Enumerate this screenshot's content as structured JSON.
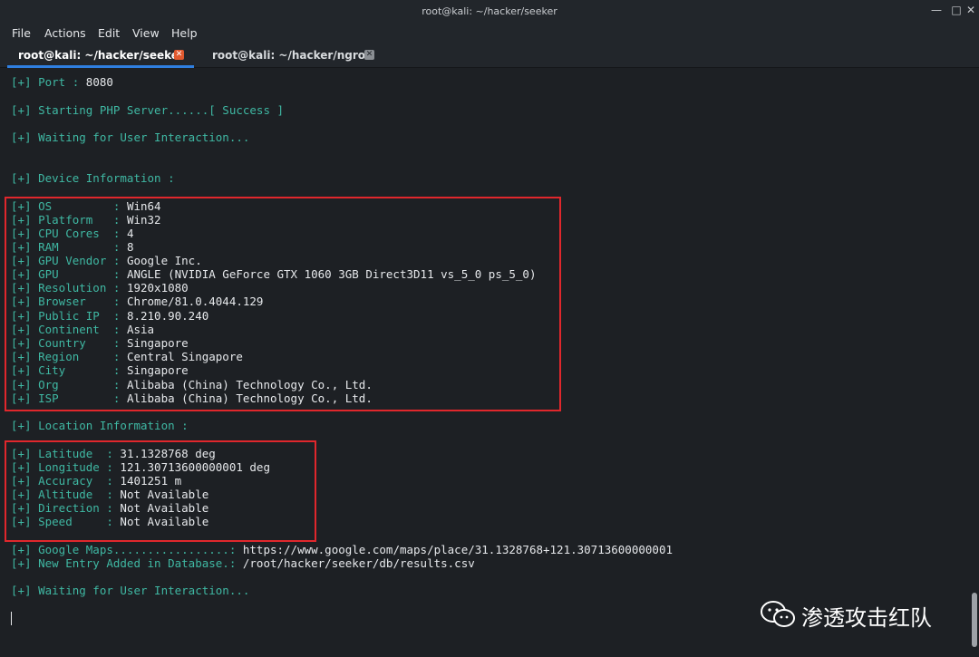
{
  "window": {
    "title": "root@kali: ~/hacker/seeker"
  },
  "menu": {
    "file": "File",
    "actions": "Actions",
    "edit": "Edit",
    "view": "View",
    "help": "Help"
  },
  "tabs": [
    {
      "label": "root@kali: ~/hacker/seeker"
    },
    {
      "label": "root@kali: ~/hacker/ngrok"
    }
  ],
  "terminal": {
    "prefix": "[+]",
    "lines": {
      "port": {
        "label": " Port : ",
        "value": "8080"
      },
      "php": {
        "label": " Starting PHP Server......[ Success ]"
      },
      "wait1": {
        "label": " Waiting for User Interaction..."
      },
      "devhdr": {
        "label": " Device Information :"
      },
      "os": {
        "label": " OS         : ",
        "value": "Win64"
      },
      "platform": {
        "label": " Platform   : ",
        "value": "Win32"
      },
      "cpu": {
        "label": " CPU Cores  : ",
        "value": "4"
      },
      "ram": {
        "label": " RAM        : ",
        "value": "8"
      },
      "gpuvendor": {
        "label": " GPU Vendor : ",
        "value": "Google Inc."
      },
      "gpu": {
        "label": " GPU        : ",
        "value": "ANGLE (NVIDIA GeForce GTX 1060 3GB Direct3D11 vs_5_0 ps_5_0)"
      },
      "resolution": {
        "label": " Resolution : ",
        "value": "1920x1080"
      },
      "browser": {
        "label": " Browser    : ",
        "value": "Chrome/81.0.4044.129"
      },
      "publicip": {
        "label": " Public IP  : ",
        "value": "8.210.90.240"
      },
      "continent": {
        "label": " Continent  : ",
        "value": "Asia"
      },
      "country": {
        "label": " Country    : ",
        "value": "Singapore"
      },
      "region": {
        "label": " Region     : ",
        "value": "Central Singapore"
      },
      "city": {
        "label": " City       : ",
        "value": "Singapore"
      },
      "org": {
        "label": " Org        : ",
        "value": "Alibaba (China) Technology Co., Ltd."
      },
      "isp": {
        "label": " ISP        : ",
        "value": "Alibaba (China) Technology Co., Ltd."
      },
      "lochdr": {
        "label": " Location Information :"
      },
      "latitude": {
        "label": " Latitude  : ",
        "value": "31.1328768 deg"
      },
      "longitude": {
        "label": " Longitude : ",
        "value": "121.30713600000001 deg"
      },
      "accuracy": {
        "label": " Accuracy  : ",
        "value": "1401251 m"
      },
      "altitude": {
        "label": " Altitude  : ",
        "value": "Not Available"
      },
      "direction": {
        "label": " Direction : ",
        "value": "Not Available"
      },
      "speed": {
        "label": " Speed     : ",
        "value": "Not Available"
      },
      "maps": {
        "label": " Google Maps.................: ",
        "value": "https://www.google.com/maps/place/31.1328768+121.30713600000001"
      },
      "db": {
        "label": " New Entry Added in Database.: ",
        "value": "/root/hacker/seeker/db/results.csv"
      },
      "wait2": {
        "label": " Waiting for User Interaction..."
      }
    }
  },
  "watermark": {
    "text": "渗透攻击红队",
    "icon": "wechat-icon"
  },
  "colors": {
    "accent": "#3fb8a3",
    "highlight_box": "#e0272c",
    "tab_underline": "#2f7fe0",
    "tab_close": "#e0592f"
  }
}
